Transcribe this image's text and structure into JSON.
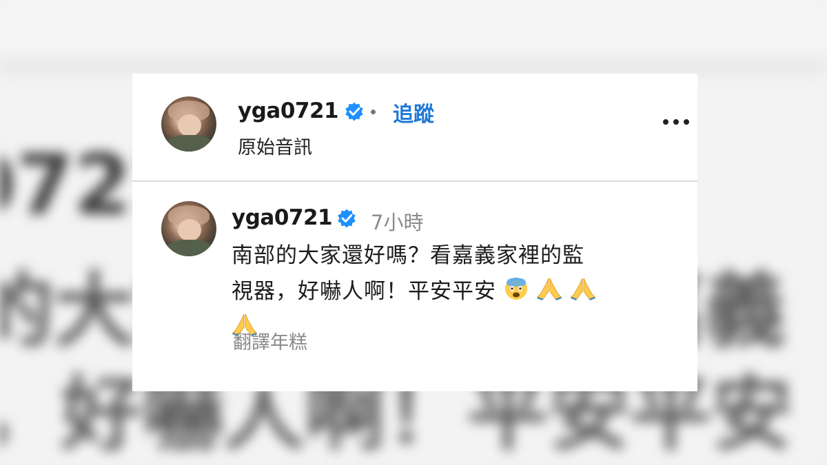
{
  "background_text": {
    "line1": "0721",
    "line2": "的大家還好嗎？看嘉義",
    "line3": "，好嚇人啊！平安平安"
  },
  "post": {
    "username": "yga0721",
    "follow_label": "追蹤",
    "audio_label": "原始音訊",
    "more_icon": "more-options-icon"
  },
  "comment": {
    "username": "yga0721",
    "time": "7小時",
    "text_line1": "南部的大家還好嗎？看嘉義家裡的監",
    "text_line2": "視器，好嚇人啊！平安平安",
    "emojis": [
      "fearful-face-emoji",
      "folded-hands-emoji",
      "folded-hands-emoji",
      "folded-hands-emoji"
    ],
    "translate_label": "翻譯年糕"
  },
  "colors": {
    "verified": "#1e90ff",
    "follow": "#1e78d8",
    "muted": "#8a8a8a"
  }
}
